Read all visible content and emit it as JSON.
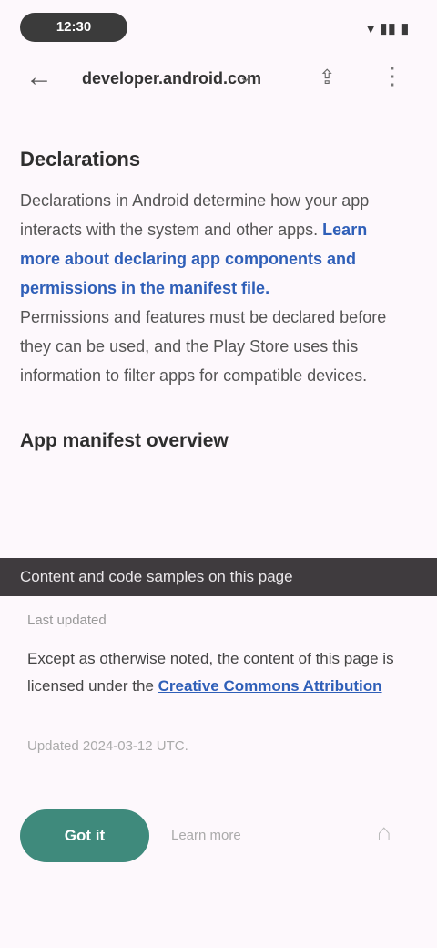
{
  "status": {
    "time": "12:30",
    "icons": "▾ ▮▮ ▮"
  },
  "toolbar": {
    "url": "developer.android.com",
    "chevron": "⌄",
    "share": "⇪",
    "more": "⋮",
    "back": "←"
  },
  "main": {
    "heading": "Declarations",
    "para1_text": "Declarations in Android determine how your app interacts with the system and other apps. ",
    "para1_link": "Learn more about declaring app components and permissions in the manifest file.",
    "para2": "Permissions and features must be declared before they can be used, and the Play Store uses this information to filter apps for compatible devices.",
    "section_title": "App manifest overview"
  },
  "banner": {
    "text": "Content and code samples on this page"
  },
  "card": {
    "caption": "Last updated",
    "text_start": "Except as otherwise noted, the content of this page is licensed under the ",
    "text_link": "Creative Commons Attribution",
    "meta": "Updated 2024-03-12 UTC."
  },
  "footer": {
    "primary_button": "Got it",
    "aside": "Learn more",
    "right_icon": "⌂"
  }
}
